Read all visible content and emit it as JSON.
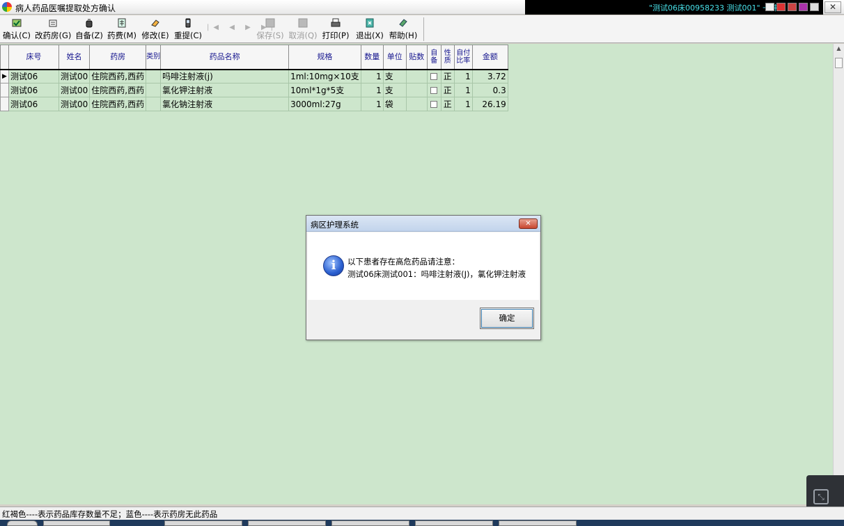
{
  "window": {
    "title": "病人药品医嘱提取处方确认",
    "patient_info": "\"测试06床00958233 测试001\" 一神",
    "close_glyph": "✕"
  },
  "toolbar": {
    "items": [
      {
        "label": "确认(C)",
        "icon": "check-icon",
        "enabled": true
      },
      {
        "label": "改药房(G)",
        "icon": "pharmacy-icon",
        "enabled": true
      },
      {
        "label": "自备(Z)",
        "icon": "bottle-icon",
        "enabled": true
      },
      {
        "label": "药费(M)",
        "icon": "calculator-icon",
        "enabled": true
      },
      {
        "label": "修改(E)",
        "icon": "eraser-icon",
        "enabled": true
      },
      {
        "label": "重提(C)",
        "icon": "phone-icon",
        "enabled": true
      },
      {
        "label": "保存(S)",
        "icon": "save-icon",
        "enabled": false
      },
      {
        "label": "取消(Q)",
        "icon": "cancel-icon",
        "enabled": false
      },
      {
        "label": "打印(P)",
        "icon": "printer-icon",
        "enabled": true
      },
      {
        "label": "退出(X)",
        "icon": "exit-icon",
        "enabled": true
      },
      {
        "label": "帮助(H)",
        "icon": "help-book-icon",
        "enabled": true
      }
    ],
    "nav": "|◀ ◀ ▶ ▶|"
  },
  "table": {
    "columns": [
      "床号",
      "姓名",
      "药房",
      "类别",
      "药品名称",
      "规格",
      "数量",
      "单位",
      "贴数",
      "自备",
      "性质",
      "自付比率",
      "金额"
    ],
    "rows": [
      {
        "bed": "测试06",
        "name": "测试00",
        "pharmacy": "住院西药,西药",
        "category": "",
        "drug": "吗啡注射液(j)",
        "spec": "1ml:10mg×10支",
        "qty": "1",
        "unit": "支",
        "doses": "",
        "self": "",
        "nature": "正",
        "ratio": "1",
        "amount": "3.72",
        "current": true
      },
      {
        "bed": "测试06",
        "name": "测试00",
        "pharmacy": "住院西药,西药",
        "category": "",
        "drug": "氯化钾注射液",
        "spec": "10ml*1g*5支",
        "qty": "1",
        "unit": "支",
        "doses": "",
        "self": "",
        "nature": "正",
        "ratio": "1",
        "amount": "0.3",
        "current": false
      },
      {
        "bed": "测试06",
        "name": "测试00",
        "pharmacy": "住院西药,西药",
        "category": "",
        "drug": "氯化钠注射液",
        "spec": "3000ml:27g",
        "qty": "1",
        "unit": "袋",
        "doses": "",
        "self": "",
        "nature": "正",
        "ratio": "1",
        "amount": "26.19",
        "current": false
      }
    ]
  },
  "dialog": {
    "title": "病区护理系统",
    "line1": "以下患者存在高危药品请注意：",
    "line2": "测试06床测试001：吗啡注射液(J)，氯化钾注射液",
    "ok_label": "确定",
    "close_glyph": "✕",
    "icon_glyph": "i"
  },
  "status": {
    "legend": "红褐色----表示药品库存数量不足；蓝色----表示药房无此药品"
  },
  "colors": {
    "main_background": "#cde6cc",
    "header_text": "#15158e",
    "title_info_text": "#48e0e8"
  }
}
